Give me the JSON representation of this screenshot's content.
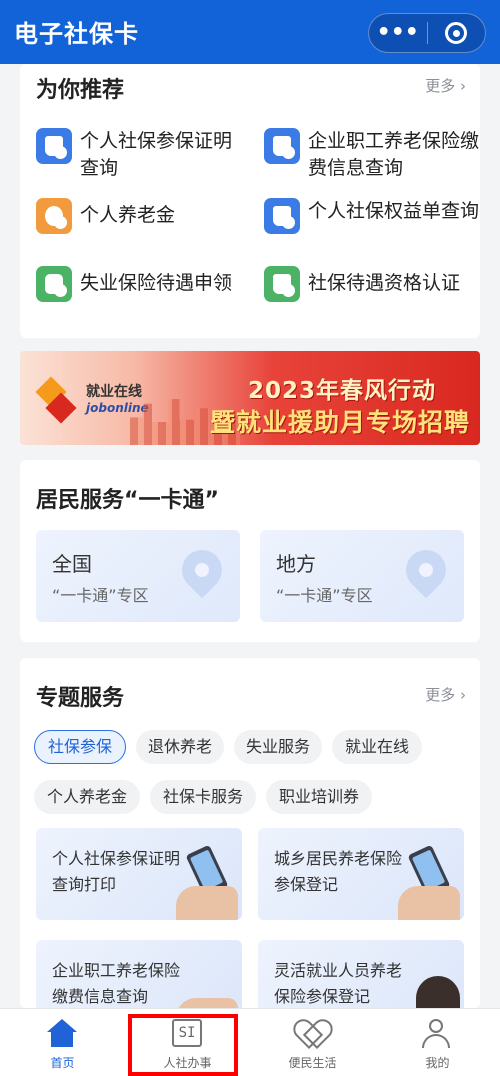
{
  "header": {
    "title": "电子社保卡",
    "more_glyph": "•••",
    "target_icon": "record-icon"
  },
  "recommend": {
    "title": "为你推荐",
    "more": "更多 ›",
    "items": [
      {
        "label": "个人社保参保证明查询",
        "icon": "document-search-icon",
        "color": "#3b7be6"
      },
      {
        "label": "企业职工养老保险缴费信息查询",
        "icon": "document-search-icon",
        "color": "#3b7be6"
      },
      {
        "label": "个人养老金",
        "icon": "piggy-bank-icon",
        "color": "#f29b3e"
      },
      {
        "label": "个人社保权益单查询",
        "icon": "document-search-icon",
        "color": "#3b7be6"
      },
      {
        "label": "失业保险待遇申领",
        "icon": "bag-icon",
        "color": "#4cb366"
      },
      {
        "label": "社保待遇资格认证",
        "icon": "document-check-icon",
        "color": "#4cb366"
      }
    ]
  },
  "banner": {
    "brand": "就业在线",
    "brand_en": "jobonline",
    "line1": "2023年春风行动",
    "line2": "暨就业援助月专场招聘"
  },
  "one_card": {
    "title": "居民服务“一卡通”",
    "tiles": [
      {
        "title": "全国",
        "subtitle": "“一卡通”专区"
      },
      {
        "title": "地方",
        "subtitle": "“一卡通”专区"
      }
    ]
  },
  "special": {
    "title": "专题服务",
    "more": "更多 ›",
    "chips": [
      "社保参保",
      "退休养老",
      "失业服务",
      "就业在线",
      "个人养老金",
      "社保卡服务",
      "职业培训券"
    ],
    "active_chip": "社保参保",
    "cards": [
      {
        "label": "个人社保参保证明查询打印"
      },
      {
        "label": "城乡居民养老保险参保登记"
      },
      {
        "label": "企业职工养老保险缴费信息查询"
      },
      {
        "label": "灵活就业人员养老保险参保登记"
      }
    ]
  },
  "tabbar": {
    "tabs": [
      {
        "label": "首页",
        "icon": "home-icon"
      },
      {
        "label": "人社办事",
        "icon": "si-icon"
      },
      {
        "label": "便民生活",
        "icon": "handshake-heart-icon"
      },
      {
        "label": "我的",
        "icon": "user-icon"
      }
    ],
    "active": "首页",
    "si_text": "SI"
  },
  "highlight_color": "#ff0000"
}
